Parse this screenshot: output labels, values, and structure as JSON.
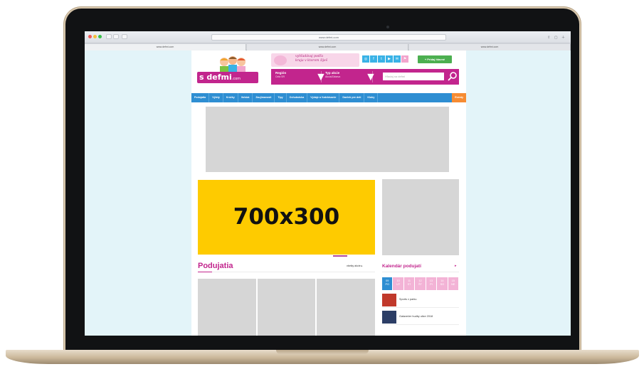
{
  "browser": {
    "url": "www.defmi.com",
    "tabs": [
      "www.defmi.com",
      "www.defmi.com",
      "www.defmi.com"
    ],
    "toolbar_icons": [
      "share-icon",
      "tabs-icon",
      "plus-icon"
    ]
  },
  "site": {
    "logo_text": "s defmi",
    "logo_suffix": ".com",
    "promo_line1": "vyhľadávaj podľa",
    "promo_line2": "kraja v ktorom žiješ",
    "social_icons": [
      "instagram-icon",
      "facebook-icon",
      "twitter-icon",
      "youtube-icon",
      "mail-icon",
      "flag-icon"
    ],
    "add_button": "+ Pridaj hlavné",
    "filters": [
      {
        "label": "Región",
        "value": "Celá SR"
      },
      {
        "label": "Typ akcie",
        "value": "Akcia/Zábava"
      }
    ],
    "search_placeholder": "Hľadaj na defmi",
    "nav": [
      "Podujatia",
      "Výlety",
      "Krúžky",
      "Ihriská",
      "Zaujímavosti",
      "Súťaže",
      "Tipy",
      "Ochutnávka",
      "Objavujte",
      "Výdaje a Vzdelávanie",
      "Zdravie a Životný štýl",
      "Darček pre deti",
      "Kluby",
      "Eventy"
    ],
    "hero_text": "700x300",
    "section_title": "Podujatia",
    "more_link": "všetky akcie ▸",
    "calendar_title": "Kalendár podujatí",
    "calendar_arrow": "▸",
    "calendar_days": [
      {
        "num": "09",
        "wd": "PO"
      },
      {
        "num": "10",
        "wd": "UT"
      },
      {
        "num": "11",
        "wd": "ST"
      },
      {
        "num": "12",
        "wd": "ŠT"
      },
      {
        "num": "13",
        "wd": "PI"
      },
      {
        "num": "14",
        "wd": "SO"
      },
      {
        "num": "15",
        "wd": "NE"
      }
    ],
    "calendar_items": [
      {
        "title": "Sports v parku",
        "thumb_color": "#c0392b"
      },
      {
        "title": "Galavečer hudby ulice 2018",
        "thumb_color": "#2c3e66"
      }
    ]
  },
  "colors": {
    "brand_pink": "#c2258d",
    "nav_blue": "#2e8ed2",
    "accent_orange": "#f68b32",
    "hero_yellow": "#fecb00"
  }
}
